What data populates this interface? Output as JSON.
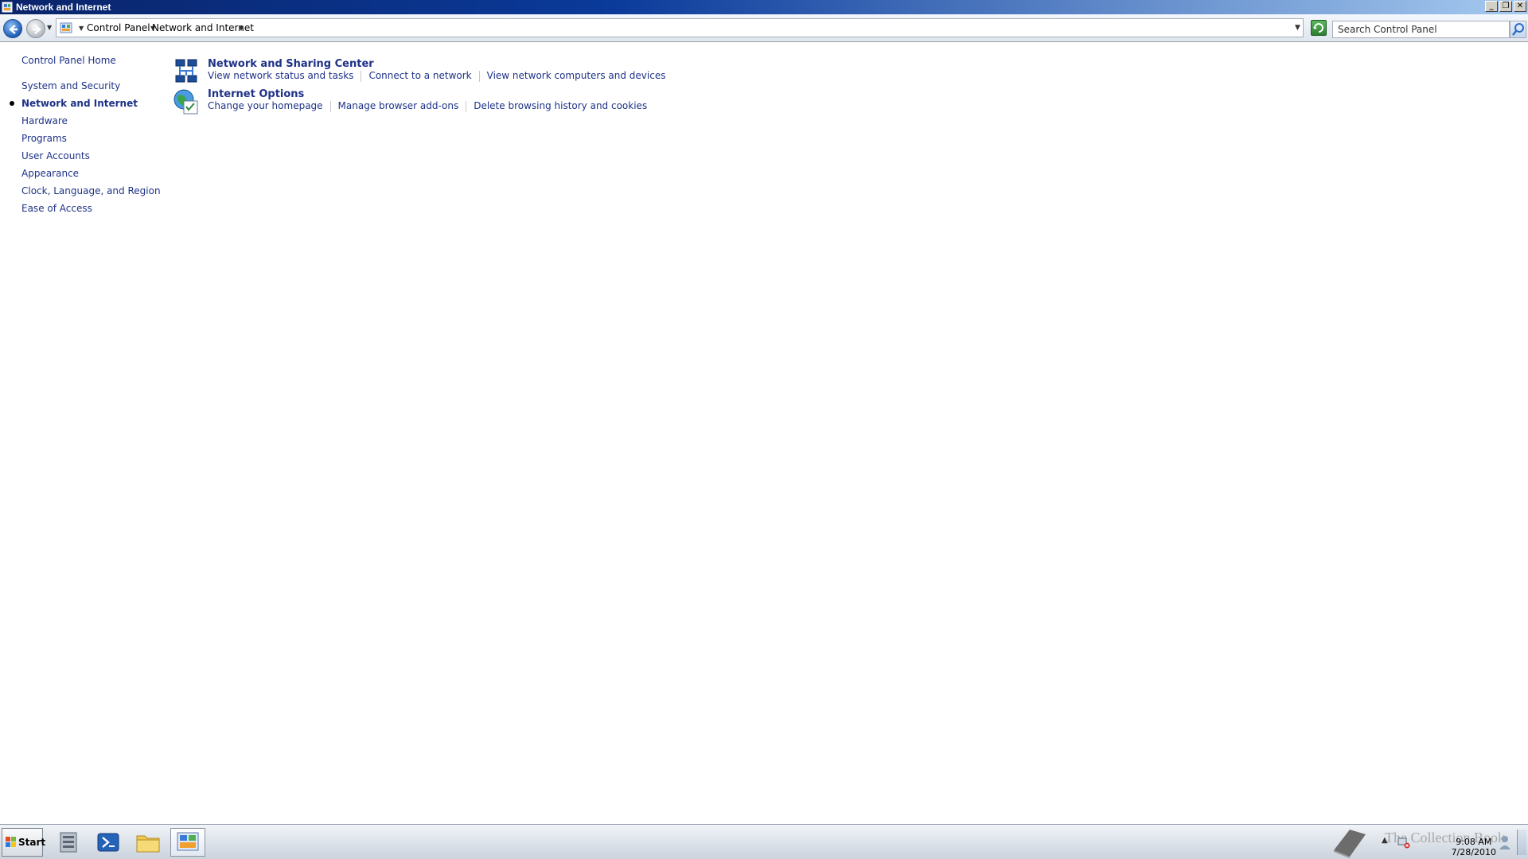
{
  "window": {
    "title": "Network and Internet"
  },
  "address": {
    "crumbs": [
      "Control Panel",
      "Network and Internet"
    ],
    "search_placeholder": "Search Control Panel"
  },
  "sidebar": {
    "home": "Control Panel Home",
    "items": [
      {
        "label": "System and Security",
        "active": false
      },
      {
        "label": "Network and Internet",
        "active": true
      },
      {
        "label": "Hardware",
        "active": false
      },
      {
        "label": "Programs",
        "active": false
      },
      {
        "label": "User Accounts",
        "active": false
      },
      {
        "label": "Appearance",
        "active": false
      },
      {
        "label": "Clock, Language, and Region",
        "active": false
      },
      {
        "label": "Ease of Access",
        "active": false
      }
    ]
  },
  "categories": [
    {
      "title": "Network and Sharing Center",
      "icon": "network-sharing-icon",
      "tasks": [
        "View network status and tasks",
        "Connect to a network",
        "View network computers and devices"
      ]
    },
    {
      "title": "Internet Options",
      "icon": "internet-options-icon",
      "tasks": [
        "Change your homepage",
        "Manage browser add-ons",
        "Delete browsing history and cookies"
      ]
    }
  ],
  "taskbar": {
    "start_label": "Start",
    "watermark": "The Collection Book",
    "clock_time": "9:08 AM",
    "clock_date": "7/28/2010"
  },
  "colors": {
    "link": "#1e3287",
    "titlebar": "#0a246a"
  }
}
